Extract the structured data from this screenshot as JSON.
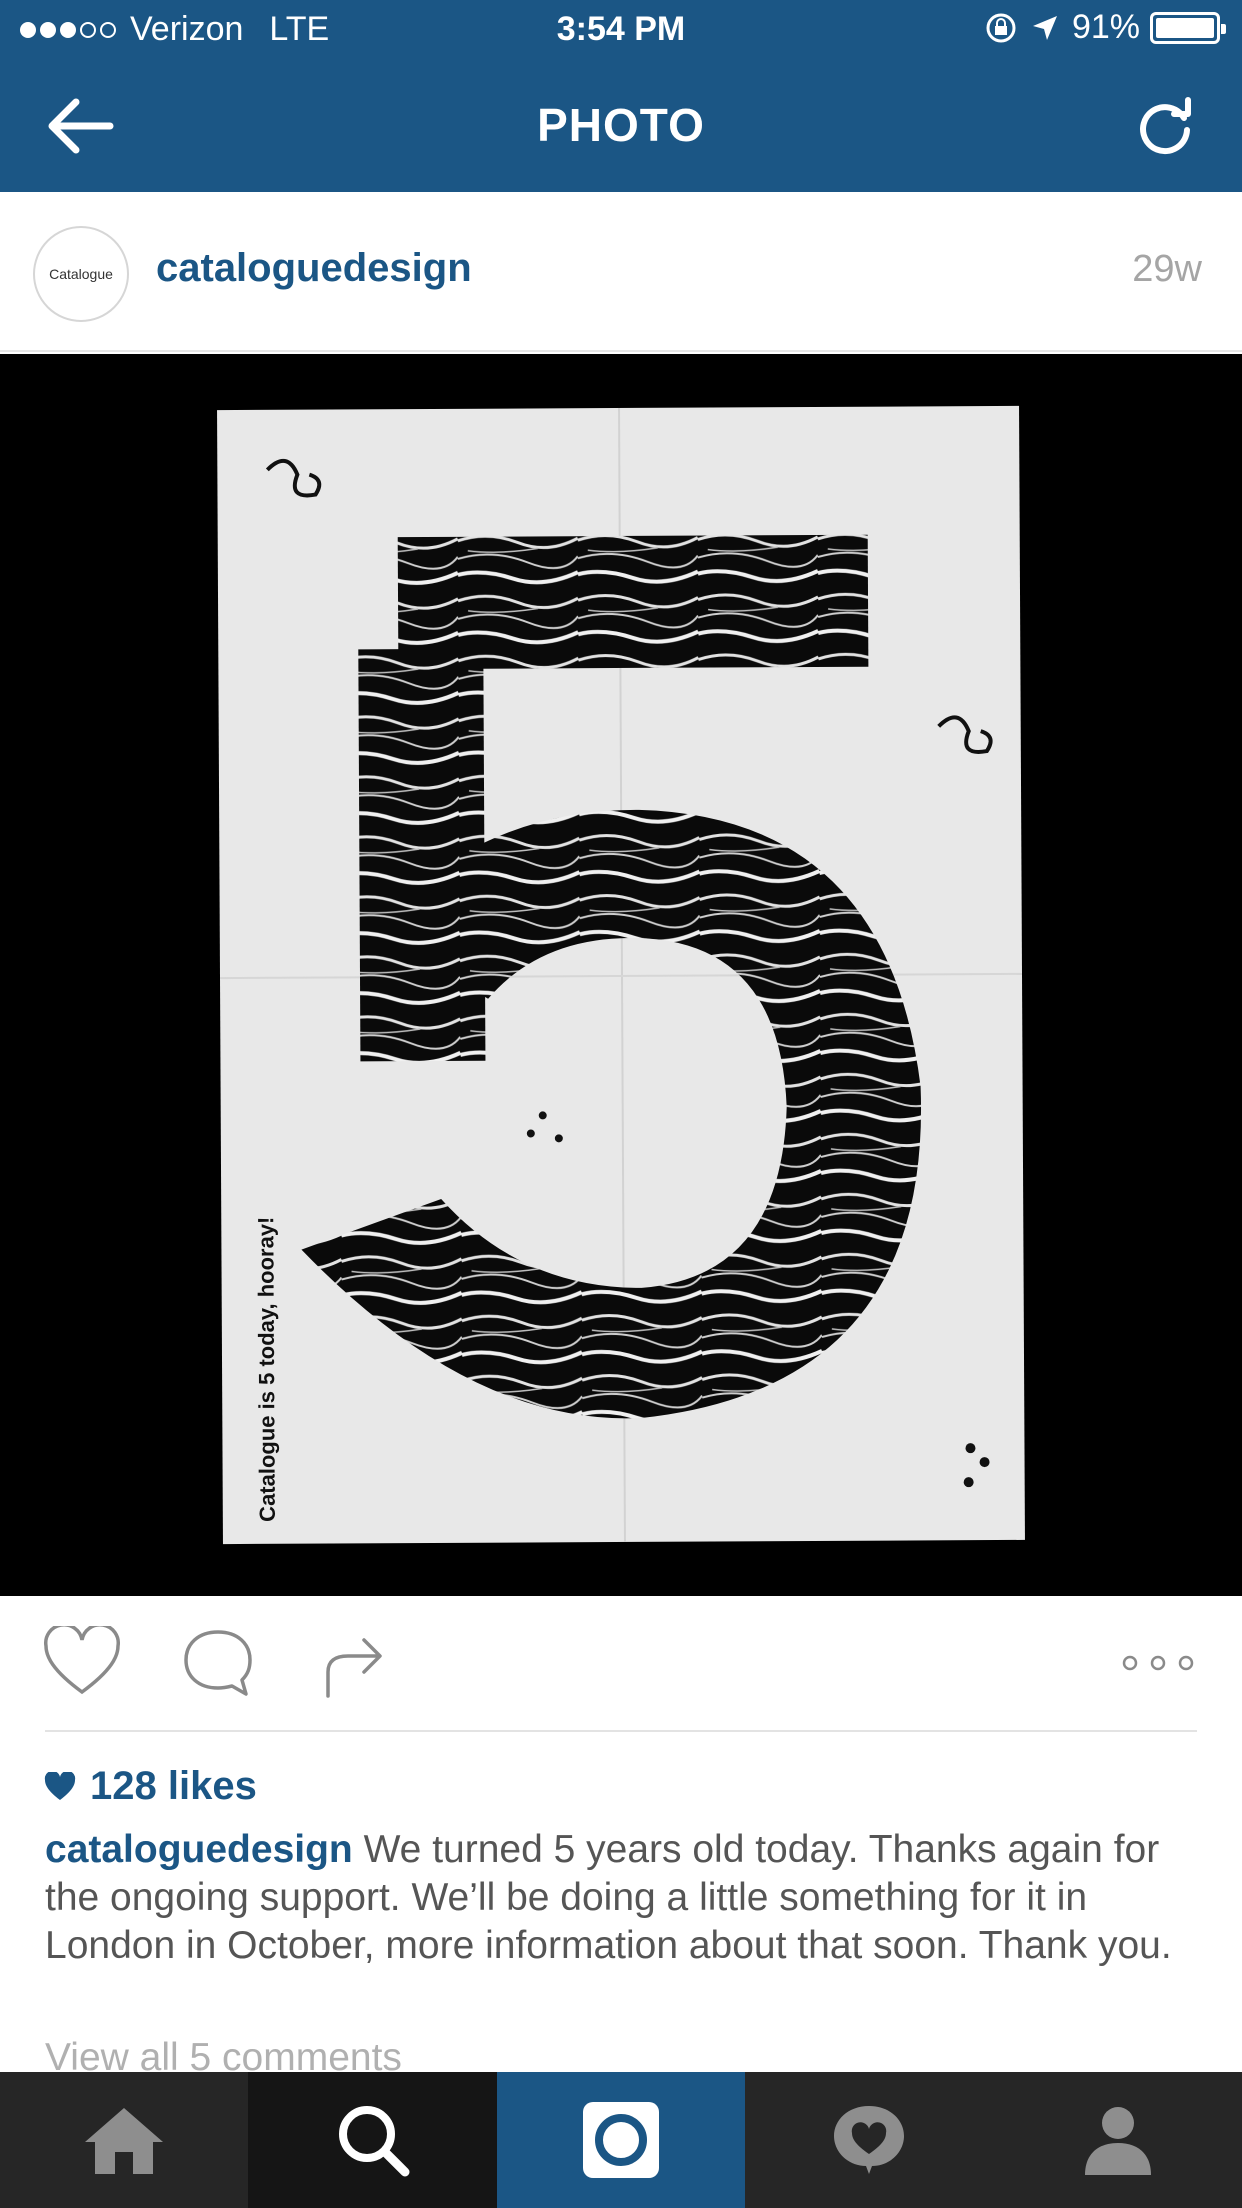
{
  "status_bar": {
    "carrier": "Verizon",
    "network": "LTE",
    "time": "3:54 PM",
    "battery": "91%",
    "signal_bars_filled": 3,
    "signal_bars_total": 5
  },
  "nav": {
    "title": "PHOTO",
    "back_icon": "arrow-left-icon",
    "refresh_icon": "refresh-icon"
  },
  "post": {
    "avatar_text": "Catalogue",
    "username": "cataloguedesign",
    "age": "29w",
    "poster_caption": "Catalogue is 5 today, hooray!",
    "poster_numeral": "5",
    "likes": "128 likes",
    "caption_username": "cataloguedesign",
    "caption_text": " We turned 5 years old today. Thanks again for the ongoing support. We’ll be doing a little something for it in London in October, more information about that soon. Thank you.",
    "view_all": "View all 5 comments"
  },
  "actions": {
    "like_icon": "heart-icon",
    "comment_icon": "comment-icon",
    "share_icon": "share-icon",
    "more_icon": "more-icon"
  },
  "tabbar": {
    "items": [
      "home-icon",
      "search-icon",
      "camera-icon",
      "activity-icon",
      "profile-icon"
    ],
    "active": [
      "search-icon",
      "camera-icon"
    ]
  },
  "colors": {
    "brand": "#1b5685",
    "tabbar": "#262626",
    "muted": "#a5a5a5"
  }
}
